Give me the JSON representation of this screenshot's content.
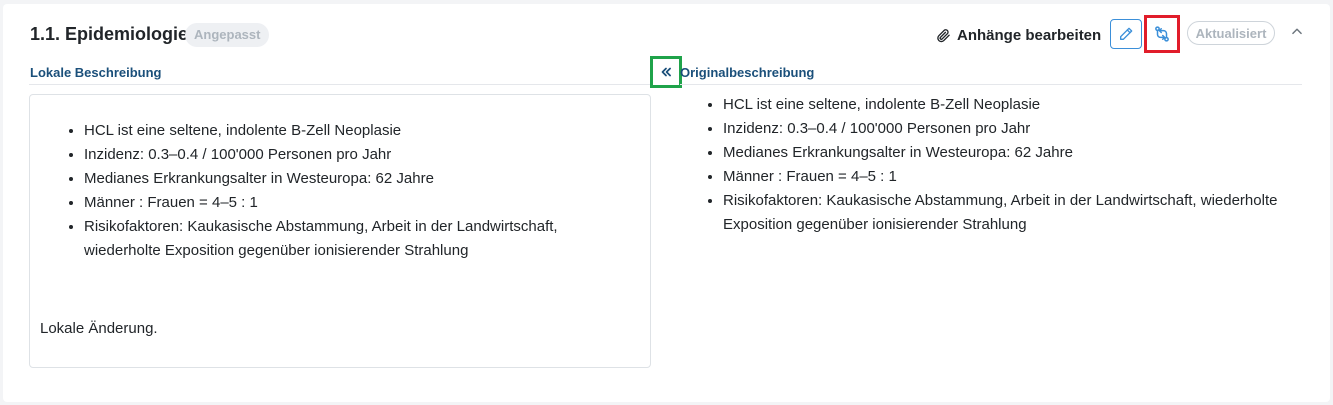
{
  "section": {
    "title": "1.1. Epidemiologie",
    "badge": "Angepasst"
  },
  "toolbar": {
    "attachments_label": "Anhänge bearbeiten",
    "attachments_icon": "paperclip-icon",
    "edit_icon": "pencil-icon",
    "compare_icon": "compare-arrows-icon",
    "updated_label": "Aktualisiert",
    "collapse_icon": "chevron-up-icon"
  },
  "local": {
    "label": "Lokale Beschreibung",
    "items": [
      "HCL ist eine seltene, indolente B-Zell Neoplasie",
      "Inzidenz: 0.3–0.4 / 100'000 Personen pro Jahr",
      "Medianes Erkrankungsalter in Westeuropa: 62 Jahre",
      "Männer : Frauen = 4–5 : 1",
      "Risikofaktoren: Kaukasische Abstammung, Arbeit in der Landwirtschaft, wiederholte Exposition gegenüber ionisierender Strahlung"
    ],
    "note": "Lokale Änderung."
  },
  "copy_button_icon": "double-chevron-left-icon",
  "original": {
    "label": "Originalbeschreibung",
    "items": [
      "HCL ist eine seltene, indolente B-Zell Neoplasie",
      "Inzidenz: 0.3–0.4 / 100'000 Personen pro Jahr",
      "Medianes Erkrankungsalter in Westeuropa: 62 Jahre",
      "Männer : Frauen = 4–5 : 1",
      "Risikofaktoren: Kaukasische Abstammung, Arbeit in der Landwirtschaft, wiederholte Exposition gegenüber ionisierender Strahlung"
    ]
  },
  "colors": {
    "accent_blue": "#3b8fd9",
    "highlight_red": "#e11d2a",
    "highlight_green": "#1fa34a",
    "label_blue": "#1a4f7a"
  }
}
